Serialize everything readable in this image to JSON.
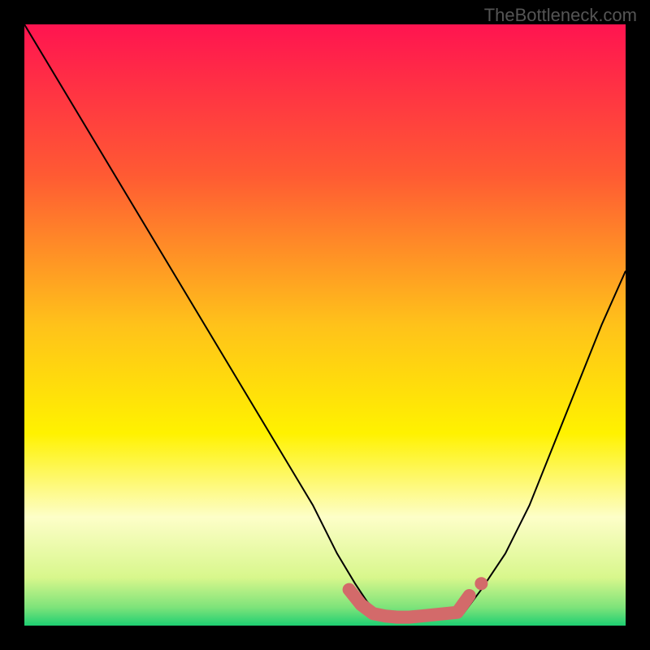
{
  "watermark": "TheBottleneck.com",
  "chart_data": {
    "type": "line",
    "title": "",
    "xlabel": "",
    "ylabel": "",
    "xlim": [
      0,
      100
    ],
    "ylim": [
      0,
      100
    ],
    "series": [
      {
        "name": "left-curve",
        "x": [
          0,
          6,
          12,
          18,
          24,
          30,
          36,
          42,
          48,
          52,
          55,
          57,
          59
        ],
        "y": [
          100,
          90,
          80,
          70,
          60,
          50,
          40,
          30,
          20,
          12,
          7,
          4,
          2
        ]
      },
      {
        "name": "right-curve",
        "x": [
          73,
          76,
          80,
          84,
          88,
          92,
          96,
          100
        ],
        "y": [
          2,
          6,
          12,
          20,
          30,
          40,
          50,
          59
        ]
      }
    ],
    "highlight_zone": {
      "name": "flat-bottom-marker",
      "x": [
        54,
        56,
        58,
        60,
        62,
        64,
        66,
        68,
        72,
        74
      ],
      "y": [
        6,
        3.5,
        2,
        1.6,
        1.4,
        1.4,
        1.6,
        1.8,
        2.2,
        5
      ]
    },
    "gradient_stops": [
      {
        "offset": 0.0,
        "color": "#ff1450"
      },
      {
        "offset": 0.25,
        "color": "#ff5a33"
      },
      {
        "offset": 0.5,
        "color": "#ffc21a"
      },
      {
        "offset": 0.68,
        "color": "#fff200"
      },
      {
        "offset": 0.82,
        "color": "#fdfec8"
      },
      {
        "offset": 0.92,
        "color": "#d8f78c"
      },
      {
        "offset": 0.97,
        "color": "#7de37a"
      },
      {
        "offset": 1.0,
        "color": "#1ecf72"
      }
    ],
    "highlight_color": "#d36a6a",
    "line_color": "#000000"
  }
}
